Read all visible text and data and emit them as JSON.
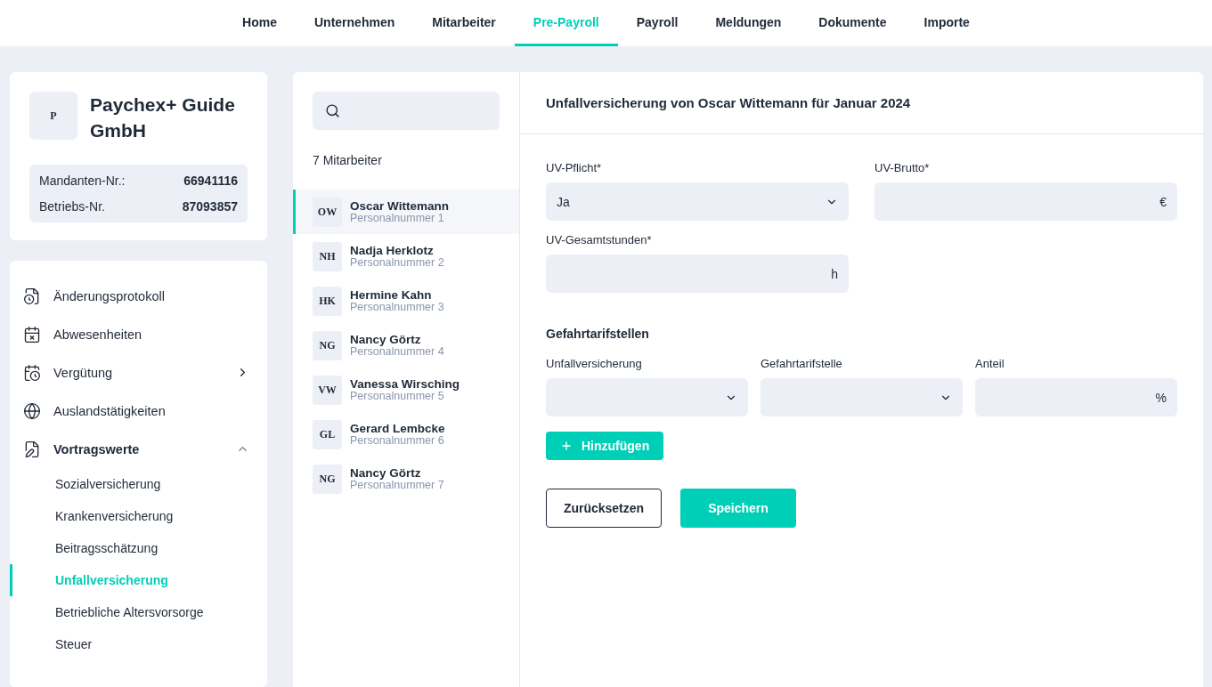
{
  "nav": [
    {
      "label": "Home",
      "selected": false
    },
    {
      "label": "Unternehmen",
      "selected": false
    },
    {
      "label": "Mitarbeiter",
      "selected": false
    },
    {
      "label": "Pre-Payroll",
      "selected": true
    },
    {
      "label": "Payroll",
      "selected": false
    },
    {
      "label": "Meldungen",
      "selected": false
    },
    {
      "label": "Dokumente",
      "selected": false
    },
    {
      "label": "Importe",
      "selected": false
    }
  ],
  "company": {
    "logo": "P",
    "name": "Paychex+ Guide GmbH",
    "details": [
      {
        "label": "Mandanten-Nr.:",
        "value": "66941116"
      },
      {
        "label": "Betriebs-Nr.",
        "value": "87093857"
      }
    ]
  },
  "sidebar": {
    "items": [
      {
        "kind": "link",
        "label": "Änderungsprotokoll"
      },
      {
        "kind": "link",
        "label": "Abwesenheiten"
      },
      {
        "kind": "group",
        "label": "Vergütung",
        "expanded": false
      },
      {
        "kind": "link",
        "label": "Auslandstätigkeiten"
      },
      {
        "kind": "group",
        "label": "Vortragswerte",
        "expanded": true,
        "children": [
          {
            "label": "Sozialversicherung",
            "selected": false
          },
          {
            "label": "Krankenversicherung",
            "selected": false
          },
          {
            "label": "Beitragsschätzung",
            "selected": false
          },
          {
            "label": "Unfallversicherung",
            "selected": true
          },
          {
            "label": "Betriebliche Altersvorsorge",
            "selected": false
          },
          {
            "label": "Steuer",
            "selected": false
          }
        ]
      }
    ]
  },
  "employees": {
    "count": "7 Mitarbeiter",
    "items": [
      {
        "initials": "OW",
        "name": "Oscar Wittemann",
        "number": "Personalnummer 1",
        "selected": true
      },
      {
        "initials": "NH",
        "name": "Nadja Herklotz",
        "number": "Personalnummer 2",
        "selected": false
      },
      {
        "initials": "HK",
        "name": "Hermine Kahn",
        "number": "Personalnummer 3",
        "selected": false
      },
      {
        "initials": "NG",
        "name": "Nancy Görtz",
        "number": "Personalnummer 4",
        "selected": false
      },
      {
        "initials": "VW",
        "name": "Vanessa Wirsching",
        "number": "Personalnummer 5",
        "selected": false
      },
      {
        "initials": "GL",
        "name": "Gerard Lembcke",
        "number": "Personalnummer 6",
        "selected": false
      },
      {
        "initials": "NG",
        "name": "Nancy Görtz",
        "number": "Personalnummer 7",
        "selected": false
      }
    ]
  },
  "form": {
    "title": "Unfallversicherung von Oscar Wittemann für Januar 2024",
    "fields": [
      {
        "kind": "select",
        "label": "UV-Pflicht*",
        "value": "Ja"
      },
      {
        "kind": "unit",
        "label": "UV-Brutto*",
        "unit": "€"
      },
      {
        "kind": "unit",
        "label": "UV-Gesamtstunden*",
        "unit": "h"
      }
    ],
    "section": "Gefahrtarifstellen",
    "row": [
      {
        "kind": "select",
        "label": "Unfallversicherung"
      },
      {
        "kind": "select",
        "label": "Gefahrtarifstelle"
      },
      {
        "kind": "unit",
        "label": "Anteil",
        "unit": "%"
      }
    ],
    "add_button": "Hinzufügen",
    "reset_button": "Zurücksetzen",
    "save_button": "Speichern"
  }
}
